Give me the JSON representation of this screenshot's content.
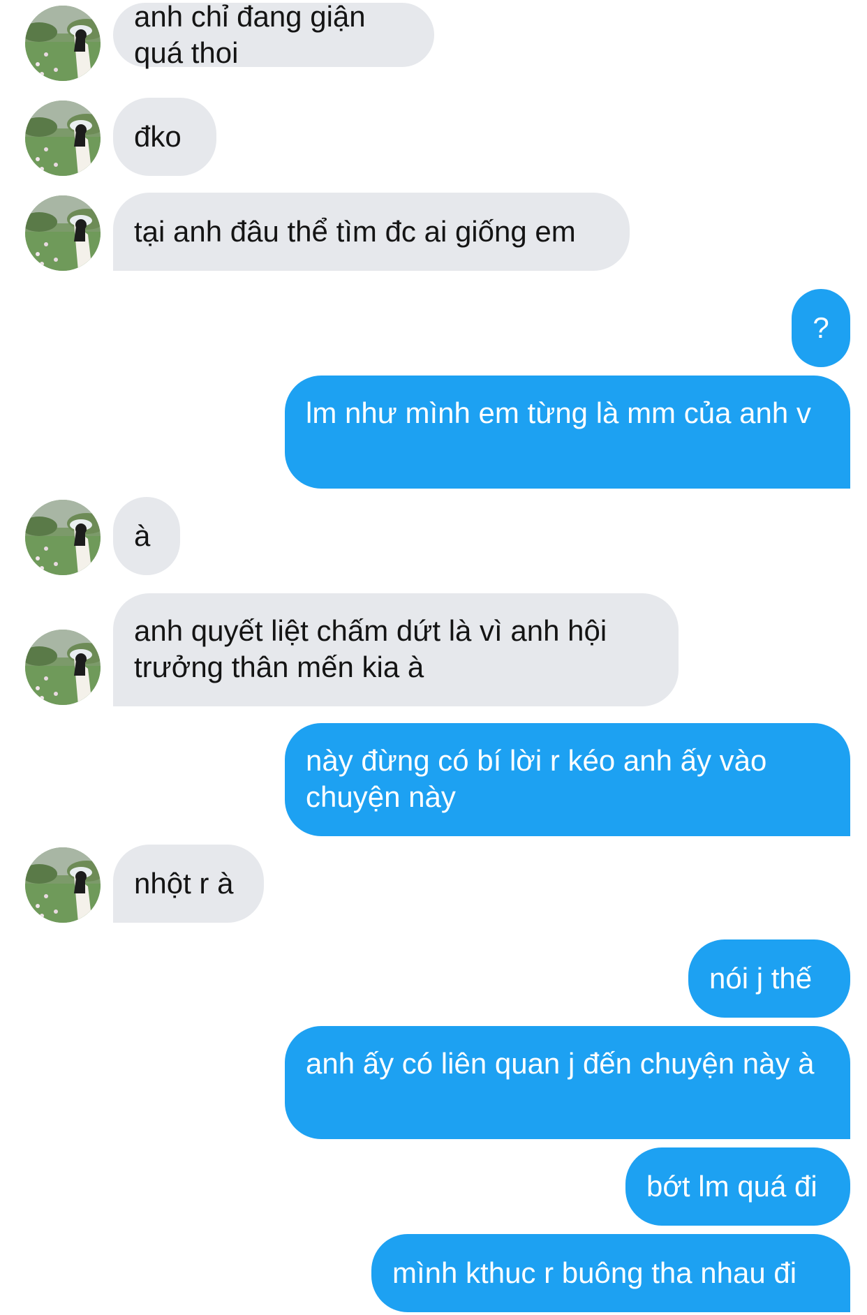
{
  "conversation": {
    "messages": [
      {
        "side": "incoming",
        "text": "anh chỉ đang giận quá thoi"
      },
      {
        "side": "incoming",
        "text": "đko"
      },
      {
        "side": "incoming",
        "text": "tại anh đâu thể tìm đc ai giống em"
      },
      {
        "side": "outgoing",
        "text": "?"
      },
      {
        "side": "outgoing",
        "text": "lm như mình em từng là mm của anh v"
      },
      {
        "side": "incoming",
        "text": "à"
      },
      {
        "side": "incoming",
        "text": "anh quyết liệt chấm dứt là vì anh hội trưởng thân mến kia à"
      },
      {
        "side": "outgoing",
        "text": "này đừng có bí lời r kéo anh ấy vào chuyện này"
      },
      {
        "side": "incoming",
        "text": "nhột r à"
      },
      {
        "side": "outgoing",
        "text": "nói j thế"
      },
      {
        "side": "outgoing",
        "text": "anh ấy có liên quan j đến chuyện này à"
      },
      {
        "side": "outgoing",
        "text": "bớt lm quá đi"
      },
      {
        "side": "outgoing",
        "text": "mình kthuc r buông tha nhau đi"
      }
    ]
  },
  "colors": {
    "incoming_bubble": "#e6e8ec",
    "incoming_text": "#141414",
    "outgoing_bubble": "#1da1f2",
    "outgoing_text": "#ffffff"
  },
  "icons": {
    "contact_avatar": "avatar-photo-girl-with-umbrella-in-field"
  }
}
